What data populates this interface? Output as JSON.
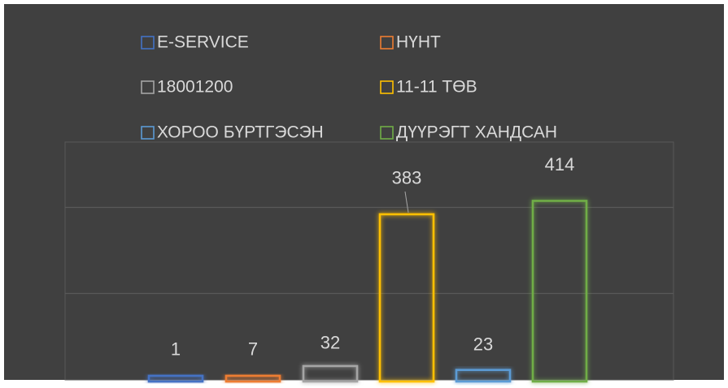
{
  "chart_data": {
    "type": "bar",
    "title": "",
    "xlabel": "",
    "ylabel": "",
    "ylim": [
      0,
      550
    ],
    "grid": true,
    "legend_position": "top",
    "categories": [
      "E-SERVICE",
      "НҮНТ",
      "18001200",
      "11-11 ТӨВ",
      "ХОРОО БҮРТГЭСЭН",
      "ДҮҮРЭГТ ХАНДСАН"
    ],
    "values": [
      1,
      7,
      32,
      383,
      23,
      414
    ],
    "labels": [
      "1",
      "7",
      "32",
      "383",
      "23",
      "414"
    ],
    "colors": [
      "#4472c4",
      "#ed7d31",
      "#a5a5a5",
      "#ffc000",
      "#5b9bd5",
      "#70ad47"
    ],
    "background": "#404040",
    "text_color": "#d9d9d9",
    "gridline_color": "#595959"
  }
}
